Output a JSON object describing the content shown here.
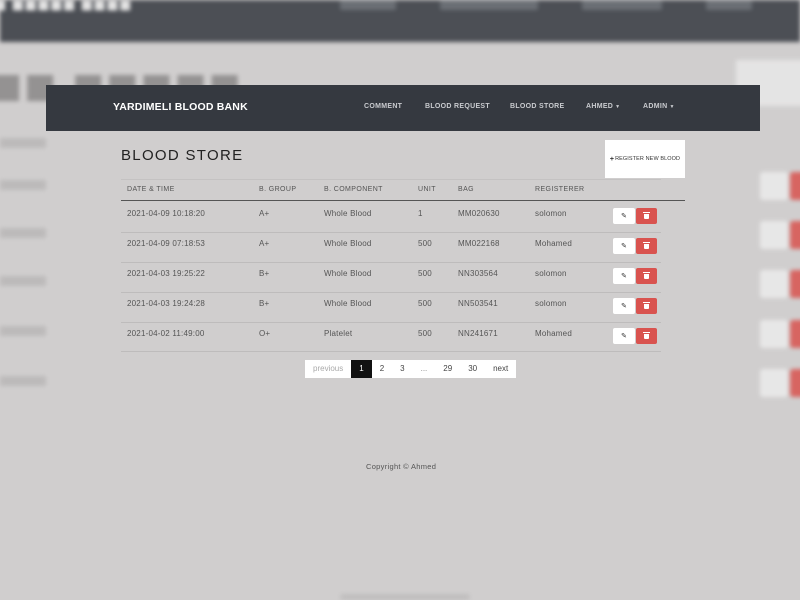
{
  "navbar": {
    "brand": "YARDIMELI BLOOD BANK",
    "links": [
      "COMMENT",
      "BLOOD REQUEST",
      "BLOOD STORE",
      "AHMED",
      "ADMIN"
    ]
  },
  "page": {
    "title": "BLOOD STORE",
    "register_label": "REGISTER NEW BLOOD"
  },
  "table": {
    "headers": [
      "DATE & TIME",
      "B. GROUP",
      "B. COMPONENT",
      "UNIT",
      "BAG",
      "REGISTERER"
    ],
    "rows": [
      [
        "2021-04-09 10:18:20",
        "A+",
        "Whole Blood",
        "1",
        "MM020630",
        "solomon"
      ],
      [
        "2021-04-09 07:18:53",
        "A+",
        "Whole Blood",
        "500",
        "MM022168",
        "Mohamed"
      ],
      [
        "2021-04-03 19:25:22",
        "B+",
        "Whole Blood",
        "500",
        "NN303564",
        "solomon"
      ],
      [
        "2021-04-03 19:24:28",
        "B+",
        "Whole Blood",
        "500",
        "NN503541",
        "solomon"
      ],
      [
        "2021-04-02 11:49:00",
        "O+",
        "Platelet",
        "500",
        "NN241671",
        "Mohamed"
      ]
    ]
  },
  "pagination": {
    "previous": "previous",
    "pages": [
      "1",
      "2",
      "3",
      "...",
      "29",
      "30"
    ],
    "next": "next",
    "active": "1"
  },
  "footer": {
    "copyright": "Copyright © Ahmed"
  },
  "colors": {
    "navbar": "#353940",
    "overlay": "#d0cece",
    "danger": "#d9534f",
    "active_page": "#111111"
  },
  "icons": {
    "edit": "edit-icon",
    "delete": "trash-icon",
    "register": "plus-icon",
    "dropdown": "caret-down-icon"
  }
}
